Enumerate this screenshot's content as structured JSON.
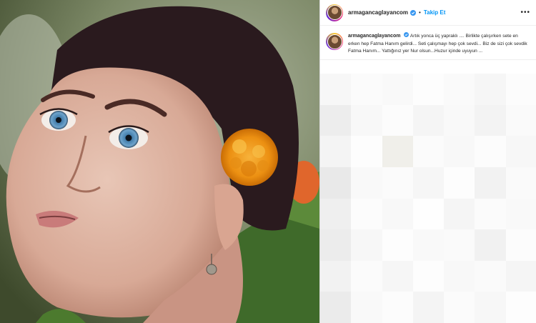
{
  "post": {
    "username": "armagancaglayancom",
    "follow_label": "Takip Et",
    "separator": "•",
    "more_label": "•••",
    "caption_text": "Artık yonca üç yapraklı .... Birlikte çalışırken sete en erken hep Fatma Hanım gelirdi... Seti çalışmayı hep çok sevdi... Biz de sizi çok sevdik Fatma Hanım... Yattığınız yer Nur olsun...Huzur içinde uyuyun ..."
  },
  "colors": {
    "follow": "#0095f6",
    "verified": "#3897f0",
    "text": "#262626"
  },
  "icons": {
    "verified": "verified-badge-icon",
    "more": "more-options-icon"
  }
}
